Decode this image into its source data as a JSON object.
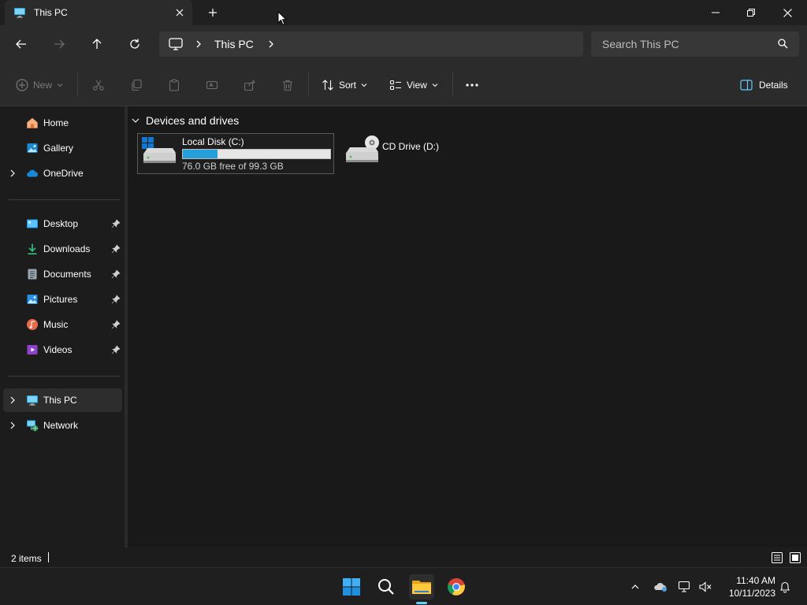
{
  "window": {
    "tab_title": "This PC",
    "tab_icon": "this-pc-icon",
    "controls": [
      "minimize-icon",
      "restore-icon",
      "close-icon"
    ]
  },
  "address_bar": {
    "breadcrumb": [
      "This PC"
    ],
    "search_placeholder": "Search This PC"
  },
  "command_bar": {
    "new_label": "New",
    "sort_label": "Sort",
    "view_label": "View",
    "details_label": "Details"
  },
  "sidebar": {
    "top": [
      {
        "label": "Home",
        "icon": "home-icon"
      },
      {
        "label": "Gallery",
        "icon": "gallery-icon"
      },
      {
        "label": "OneDrive",
        "icon": "onedrive-icon"
      }
    ],
    "pinned": [
      {
        "label": "Desktop",
        "icon": "desktop-icon"
      },
      {
        "label": "Downloads",
        "icon": "downloads-icon"
      },
      {
        "label": "Documents",
        "icon": "documents-icon"
      },
      {
        "label": "Pictures",
        "icon": "pictures-icon"
      },
      {
        "label": "Music",
        "icon": "music-icon"
      },
      {
        "label": "Videos",
        "icon": "videos-icon"
      }
    ],
    "bottom": [
      {
        "label": "This PC",
        "icon": "this-pc-icon",
        "selected": true
      },
      {
        "label": "Network",
        "icon": "network-icon"
      }
    ]
  },
  "content": {
    "group_title": "Devices and drives",
    "drives": [
      {
        "name": "Local Disk (C:)",
        "free_text": "76.0 GB free of 99.3 GB",
        "used_fraction": 0.235
      },
      {
        "name": "CD Drive (D:)"
      }
    ]
  },
  "status": {
    "item_count": "2 items"
  },
  "taskbar": {
    "clock_time": "11:40 AM",
    "clock_date": "10/11/2023"
  },
  "colors": {
    "accent": "#60cdff",
    "drive_bar": "#26a0da"
  }
}
